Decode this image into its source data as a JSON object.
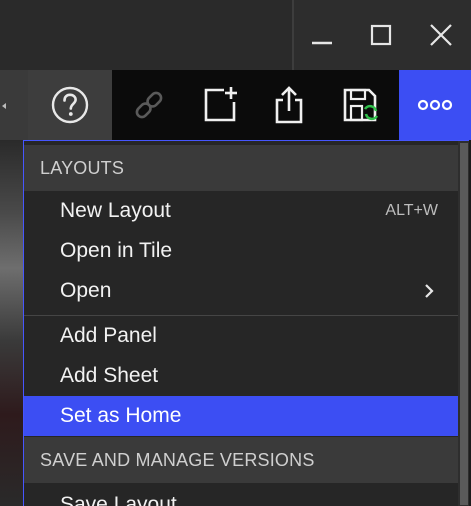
{
  "window": {
    "minimize_icon": "minimize-icon",
    "maximize_icon": "maximize-icon",
    "close_icon": "close-icon"
  },
  "toolbar": {
    "icons": [
      "help-icon",
      "link-icon",
      "new-panel-icon",
      "share-icon",
      "save-sync-icon",
      "more-icon"
    ],
    "accent": "#3c4ef3"
  },
  "menu": {
    "sections": [
      {
        "header": "LAYOUTS",
        "items": [
          {
            "label": "New Layout",
            "shortcut": "ALT+W"
          },
          {
            "label": "Open in Tile"
          },
          {
            "label": "Open",
            "submenu": true
          }
        ]
      },
      {
        "items": [
          {
            "label": "Add Panel"
          },
          {
            "label": "Add Sheet"
          },
          {
            "label": "Set as Home",
            "highlighted": true
          }
        ]
      },
      {
        "header": "SAVE AND MANAGE VERSIONS",
        "items": [
          {
            "label": "Save Layout"
          }
        ]
      }
    ]
  },
  "colors": {
    "highlight": "#3c4ef3",
    "menu_bg": "#262626",
    "header_bg": "#3a3a3a"
  }
}
